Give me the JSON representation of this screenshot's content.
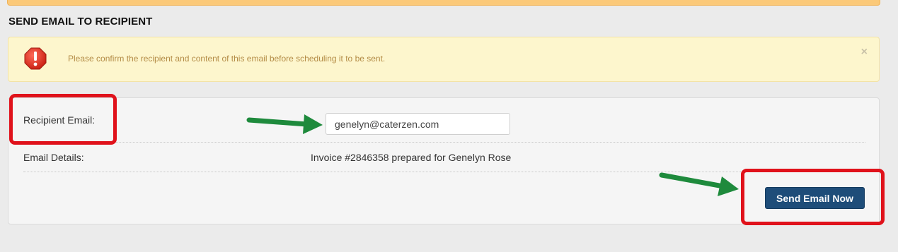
{
  "section": {
    "title": "SEND EMAIL TO RECIPIENT"
  },
  "alert": {
    "message": "Please confirm the recipient and content of this email before scheduling it to be sent.",
    "close_label": "×",
    "icon": "exclamation-octagon-icon"
  },
  "form": {
    "recipient_label": "Recipient Email:",
    "recipient_value": "genelyn@caterzen.com",
    "details_label": "Email Details:",
    "details_value": "Invoice #2846358 prepared for Genelyn Rose",
    "send_label": "Send Email Now"
  },
  "colors": {
    "banner": "#fbc979",
    "alert_background": "#fdf6cd",
    "alert_text": "#b38b45",
    "send_button": "#1e4d79",
    "annotation_highlight": "#e0121b",
    "annotation_arrow": "#1e8a3c"
  }
}
